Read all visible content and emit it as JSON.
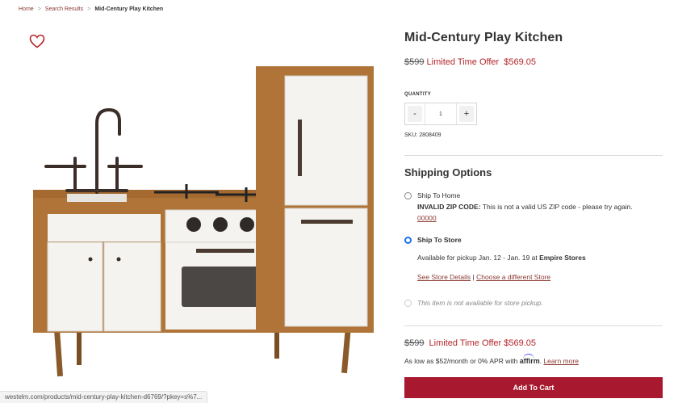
{
  "breadcrumb": {
    "items": [
      "Home",
      "Search Results"
    ],
    "separator": ">",
    "current": "Mid-Century Play Kitchen"
  },
  "wishlist": {
    "icon": "heart-icon"
  },
  "status_bar": {
    "url": "westelm.com/products/mid-century-play-kitchen-d6769/?pkey=s%7..."
  },
  "product": {
    "title": "Mid-Century Play Kitchen",
    "original_price": "$599",
    "offer_label": "Limited Time Offer",
    "offer_price": "$569.05",
    "quantity_label": "QUANTITY",
    "quantity_minus": "-",
    "quantity_value": "1",
    "quantity_plus": "+",
    "sku": "SKU: 2808409"
  },
  "shipping": {
    "title": "Shipping Options",
    "home_label": "Ship To Home",
    "home_error_bold": "INVALID ZIP CODE:",
    "home_error_text": "This is not a valid US ZIP code - please try again.",
    "home_zip": "00000",
    "store_label": "Ship To Store",
    "store_pickup_text": "Available for pickup Jan. 12 - Jan. 19 at",
    "store_name": "Empire Stores",
    "store_details_link": "See Store Details",
    "store_separator": "|",
    "choose_store_link": "Choose a different Store",
    "pickup_unavailable": "This item is not available for store pickup."
  },
  "bottom": {
    "original_price": "$599",
    "offer_label": "Limited Time Offer",
    "offer_price": "$569.05",
    "affirm_text": "As low as $52/month or 0% APR with",
    "affirm_logo": "affirm",
    "learn_more": "Learn more",
    "add_to_cart": "Add To Cart"
  },
  "colors": {
    "accent": "#a8182e",
    "offer": "#b3262c",
    "link": "#8a3a33",
    "radio": "#1a73e8"
  }
}
